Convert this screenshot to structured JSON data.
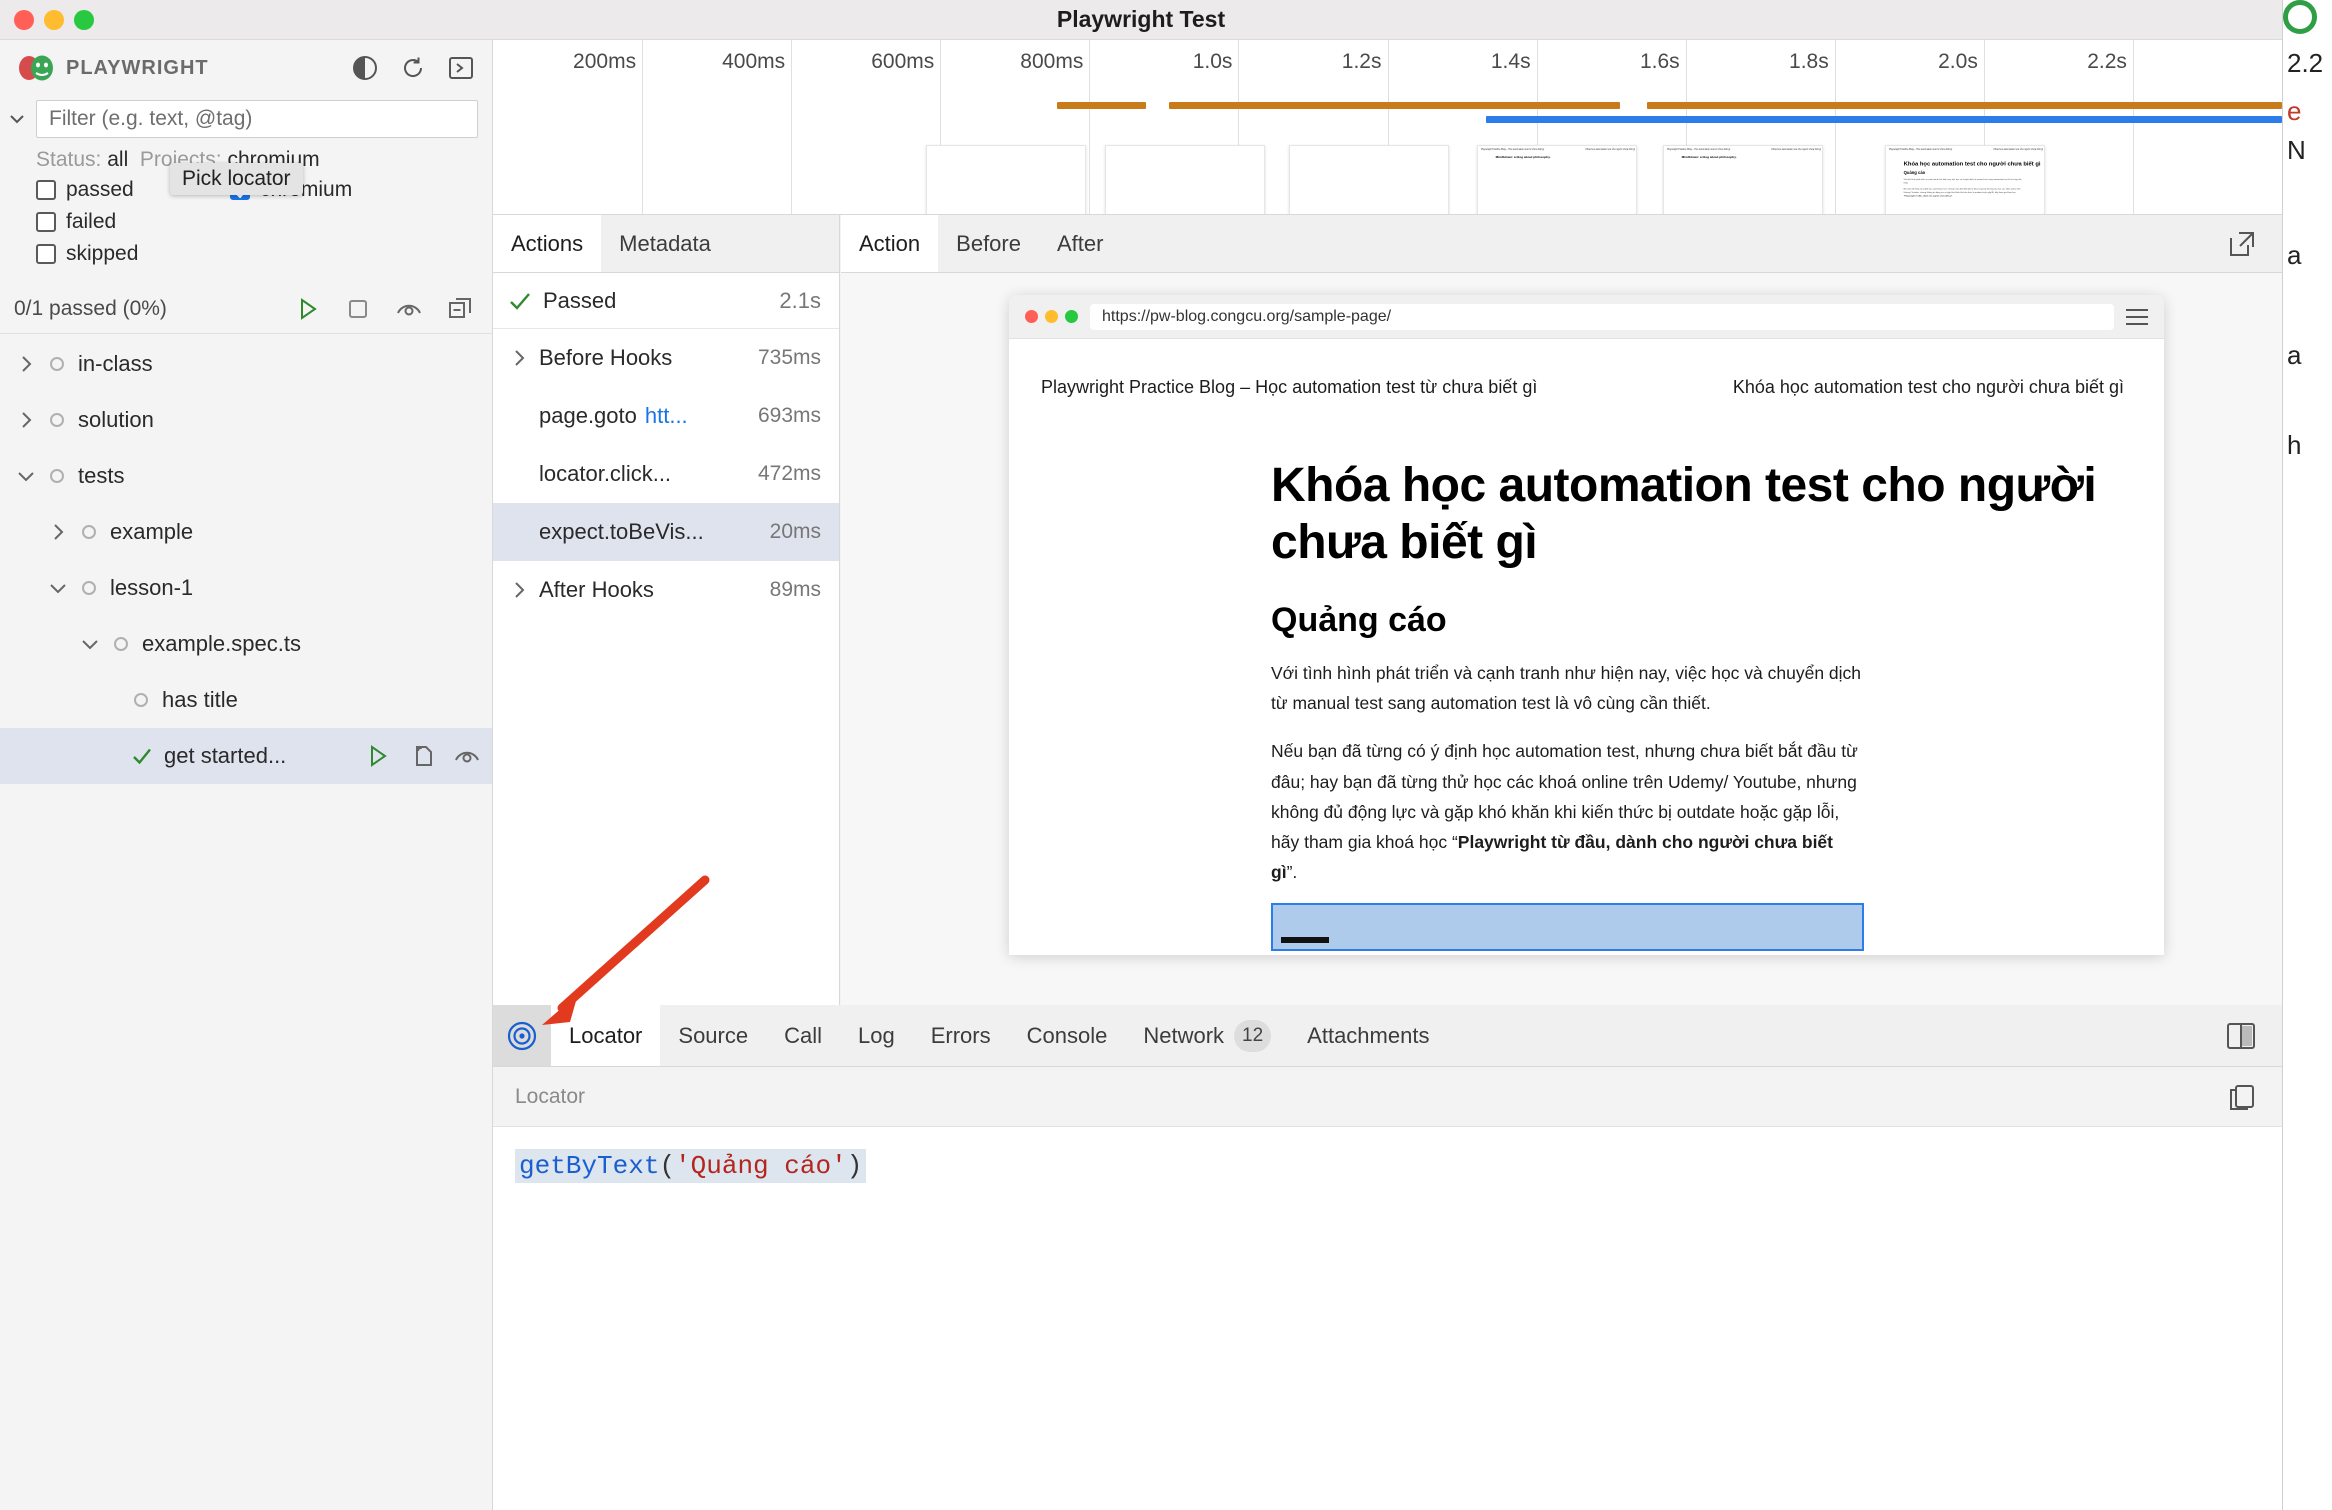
{
  "window": {
    "title": "Playwright Test"
  },
  "sidebar": {
    "brand": "PLAYWRIGHT",
    "icons": {
      "theme": "contrast-icon",
      "reload": "reload-icon",
      "terminal": "terminal-icon"
    },
    "filter": {
      "placeholder": "Filter (e.g. text, @tag)",
      "value": ""
    },
    "status_prefix": "Status:",
    "status_value": "all",
    "projects_prefix": "Projects:",
    "projects_value": "chromium",
    "status_checks": [
      {
        "label": "passed",
        "checked": false
      },
      {
        "label": "failed",
        "checked": false
      },
      {
        "label": "skipped",
        "checked": false
      }
    ],
    "project_checks": [
      {
        "label": "chromium",
        "checked": true
      }
    ],
    "summary": "0/1 passed (0%)",
    "summary_icons": [
      "run-icon",
      "stop-icon",
      "watch-icon",
      "collapse-all-icon"
    ],
    "tree": [
      {
        "label": "in-class",
        "depth": 0,
        "twist": "collapsed",
        "status": "none",
        "selected": false
      },
      {
        "label": "solution",
        "depth": 0,
        "twist": "collapsed",
        "status": "none",
        "selected": false
      },
      {
        "label": "tests",
        "depth": 0,
        "twist": "expanded",
        "status": "none",
        "selected": false
      },
      {
        "label": "example",
        "depth": 1,
        "twist": "collapsed",
        "status": "none",
        "selected": false
      },
      {
        "label": "lesson-1",
        "depth": 1,
        "twist": "expanded",
        "status": "none",
        "selected": false
      },
      {
        "label": "example.spec.ts",
        "depth": 2,
        "twist": "expanded",
        "status": "none",
        "selected": false
      },
      {
        "label": "has title",
        "depth": 3,
        "twist": "none",
        "status": "none",
        "selected": false
      },
      {
        "label": "get started...",
        "depth": 3,
        "twist": "none",
        "status": "passed",
        "selected": true,
        "icons": [
          "run-icon",
          "copy-icon",
          "watch-icon"
        ]
      }
    ]
  },
  "tooltip": {
    "text": "Pick locator"
  },
  "timeline": {
    "ticks": [
      "200ms",
      "400ms",
      "600ms",
      "800ms",
      "1.0s",
      "1.2s",
      "1.4s",
      "1.6s",
      "1.8s",
      "2.0s",
      "2.2s"
    ],
    "bars": [
      {
        "color": "#c87b19",
        "start_pct": 31.5,
        "end_pct": 36.5
      },
      {
        "color": "#c87b19",
        "start_pct": 37.8,
        "end_pct": 63.0
      },
      {
        "color": "#c87b19",
        "start_pct": 64.5,
        "end_pct": 100
      },
      {
        "color": "#2b7de9",
        "start_pct": 55.5,
        "end_pct": 100
      }
    ],
    "thumbnails": [
      {
        "left_pct": 24.2,
        "content": "blank"
      },
      {
        "left_pct": 34.2,
        "content": "blank"
      },
      {
        "left_pct": 44.5,
        "content": "blank"
      },
      {
        "left_pct": 55.0,
        "content": "page"
      },
      {
        "left_pct": 65.4,
        "content": "page"
      },
      {
        "left_pct": 77.8,
        "content": "page-ad"
      }
    ]
  },
  "actions_pane": {
    "tabs": [
      {
        "label": "Actions",
        "active": true
      },
      {
        "label": "Metadata",
        "active": false
      }
    ],
    "header": {
      "status": "Passed",
      "duration": "2.1s",
      "icon": "check-icon"
    },
    "rows": [
      {
        "label": "Before Hooks",
        "duration": "735ms",
        "twist": "collapsed",
        "indent": false,
        "selected": false
      },
      {
        "label": "page.goto",
        "url": "htt...",
        "duration": "693ms",
        "twist": "none",
        "indent": true,
        "selected": false
      },
      {
        "label": "locator.click...",
        "duration": "472ms",
        "twist": "none",
        "indent": true,
        "selected": false
      },
      {
        "label": "expect.toBeVis...",
        "duration": "20ms",
        "twist": "none",
        "indent": true,
        "selected": true
      },
      {
        "label": "After Hooks",
        "duration": "89ms",
        "twist": "collapsed",
        "indent": false,
        "selected": false
      }
    ]
  },
  "preview": {
    "tabs": [
      {
        "label": "Action",
        "active": true
      },
      {
        "label": "Before",
        "active": false
      },
      {
        "label": "After",
        "active": false
      }
    ],
    "expand_icon": "open-external-icon",
    "browser": {
      "url": "https://pw-blog.congcu.org/sample-page/",
      "menu_icon": "hamburger-icon",
      "page": {
        "site_title": "Playwright Practice Blog – Học automation test từ chưa biết gì",
        "nav_link": "Khóa học automation test cho người chưa biết gì",
        "heading": "Khóa học automation test cho người chưa biết gì",
        "subheading": "Quảng cáo",
        "paragraph1": "Với tình hình phát triển và cạnh tranh như hiện nay, việc học và chuyển dịch từ manual test sang automation test là vô cùng cần thiết.",
        "paragraph2_prefix": "Nếu bạn đã từng có ý định học automation test, nhưng chưa biết bắt đầu từ đâu; hay bạn đã từng thử học các khoá online trên Udemy/ Youtube, nhưng không đủ động lực và gặp khó khăn khi kiến thức bị outdate hoặc gặp lỗi, hãy tham gia khoá học “",
        "paragraph2_bold": "Playwright từ đầu, dành cho người chưa biết gì",
        "paragraph2_suffix": "”."
      }
    }
  },
  "bottom": {
    "pick_locator_icon": "target-icon",
    "tabs": [
      {
        "label": "Locator",
        "active": true,
        "badge": null
      },
      {
        "label": "Source",
        "active": false,
        "badge": null
      },
      {
        "label": "Call",
        "active": false,
        "badge": null
      },
      {
        "label": "Log",
        "active": false,
        "badge": null
      },
      {
        "label": "Errors",
        "active": false,
        "badge": null
      },
      {
        "label": "Console",
        "active": false,
        "badge": null
      },
      {
        "label": "Network",
        "active": false,
        "badge": "12"
      },
      {
        "label": "Attachments",
        "active": false,
        "badge": null
      }
    ],
    "split_icon": "split-view-icon",
    "locator_panel": {
      "title": "Locator",
      "copy_icon": "copy-icon",
      "code_fn": "getByText",
      "code_open": "(",
      "code_string": "'Quảng cáo'",
      "code_close": ")"
    }
  },
  "behind_window": {
    "time_label": "2.2",
    "fragments": [
      "e",
      "N",
      "a",
      "a",
      "h"
    ]
  },
  "colors": {
    "accent_blue": "#1a73e8",
    "timeline_orange": "#c87b19",
    "timeline_blue": "#2b7de9",
    "selection": "#dfe3ee",
    "pass_green": "#2f9e44",
    "annotation_red": "#e23a1f"
  }
}
